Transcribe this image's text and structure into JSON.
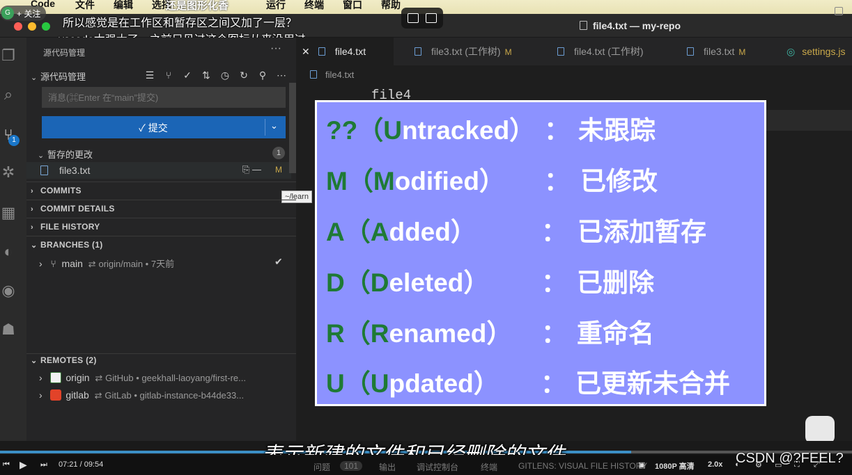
{
  "menubar": {
    "apple": "",
    "items": [
      "Code",
      "文件",
      "编辑",
      "选择",
      "运行",
      "终端",
      "窗口",
      "帮助"
    ]
  },
  "overlay": {
    "follow_label": "+ 关注",
    "danmu_1": "所以感觉是在工作区和暂存区之间又加了一层？",
    "danmu_2": "vscode太强大了，之前只见过这个图标从来没用过",
    "danmu_3": "还是图形化香"
  },
  "window": {
    "title": "file4.txt — my-repo"
  },
  "sidebar": {
    "title": "源代码管理",
    "scm_section": "源代码管理",
    "message_placeholder": "消息(⌘Enter 在“main”提交)",
    "commit_label": "✓ 提交",
    "staged_header": "暂存的更改",
    "staged_count": "1",
    "staged_file": {
      "name": "file3.txt",
      "status": "M"
    },
    "tooltip": "~/learn",
    "sections": [
      "COMMITS",
      "COMMIT DETAILS",
      "FILE HISTORY",
      "BRANCHES (1)",
      "REMOTES (2)"
    ],
    "branch": {
      "name": "main",
      "upstream": "origin/main",
      "age": "7天前"
    },
    "remotes": [
      {
        "name": "origin",
        "provider": "GitHub",
        "path": "geekhall-laoyang/first-re..."
      },
      {
        "name": "gitlab",
        "provider": "GitLab",
        "path": "gitlab-instance-b44de33..."
      }
    ]
  },
  "tabs": [
    {
      "label": "file4.txt",
      "modified": ""
    },
    {
      "label": "file3.txt (工作树)",
      "modified": "M"
    },
    {
      "label": "file4.txt (工作树)",
      "modified": ""
    },
    {
      "label": "file3.txt",
      "modified": "M"
    },
    {
      "label": "settings.js",
      "modified": ""
    }
  ],
  "editor": {
    "breadcrumb": "file4.txt",
    "line_1": "file4"
  },
  "legend": {
    "rows": [
      {
        "code": "??",
        "open": "（",
        "en_first": "U",
        "en_rest": "ntracked",
        "close": "）",
        "colon": "：",
        "cn": "未跟踪"
      },
      {
        "code": "M",
        "open": "（",
        "en_first": "M",
        "en_rest": "odified",
        "close": "）",
        "colon": "：",
        "cn": "已修改"
      },
      {
        "code": "A",
        "open": "（",
        "en_first": "A",
        "en_rest": "dded",
        "close": "）",
        "colon": "：",
        "cn": "已添加暂存"
      },
      {
        "code": "D",
        "open": "（",
        "en_first": "D",
        "en_rest": "eleted",
        "close": "）",
        "colon": "：",
        "cn": "已删除"
      },
      {
        "code": "R",
        "open": "（",
        "en_first": "R",
        "en_rest": "enamed",
        "close": "）",
        "colon": "：",
        "cn": "重命名"
      },
      {
        "code": "U",
        "open": "（",
        "en_first": "U",
        "en_rest": "pdated",
        "close": "）",
        "colon": "：",
        "cn": "已更新未合并"
      }
    ]
  },
  "player": {
    "subtitle": "表示新建的文件和已经删除的文件",
    "time": "07:21 / 09:54",
    "progress": 0.741,
    "quality": "1080P 高清",
    "speed": "2.0x",
    "watermark": "CSDN @?FEEL?",
    "status_items": [
      "问题",
      "101",
      "输出",
      "调试控制台",
      "终端",
      "GITLENS: VISUAL FILE HISTORY"
    ]
  },
  "colors": {
    "legend_bg": "#8c92ff",
    "legend_code": "#1f7a35",
    "commit_button": "#1b65b6",
    "modified": "#c9a84a"
  }
}
